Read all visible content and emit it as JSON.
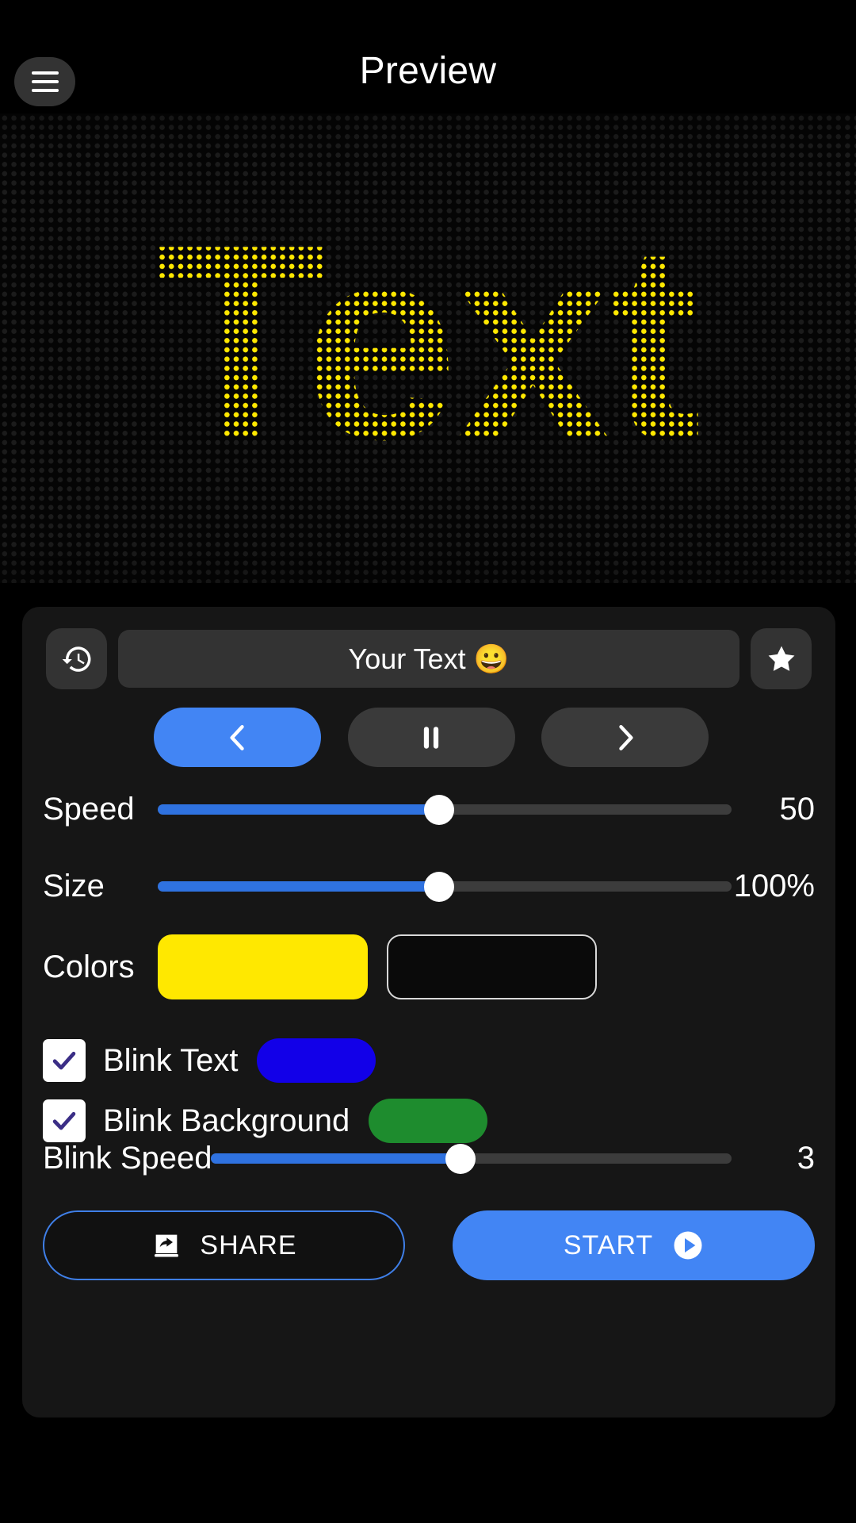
{
  "header": {
    "title": "Preview",
    "menu_icon": "hamburger-menu-icon"
  },
  "display": {
    "text": "Text",
    "text_color": "#FFE800",
    "background_color": "#050505",
    "style": "led-dot-matrix"
  },
  "controls": {
    "history_icon": "history-restore-icon",
    "input_value": "Your Text 😀",
    "input_placeholder": "Your Text",
    "favorite_icon": "star-icon",
    "playback": {
      "prev_label": "‹",
      "prev_icon": "chevron-left-icon",
      "pause_icon": "pause-icon",
      "next_icon": "chevron-right-icon",
      "active": "prev",
      "active_color": "#4285F4"
    },
    "speed": {
      "label": "Speed",
      "value": "50",
      "percent": 49,
      "min": 0,
      "max": 100
    },
    "size": {
      "label": "Size",
      "value": "100%",
      "percent": 49,
      "min": 0,
      "max": 200
    },
    "colors": {
      "label": "Colors",
      "text_color": "#FFE800",
      "background_color": "#0A0A0A"
    },
    "blink_text": {
      "label": "Blink Text",
      "checked": true,
      "color": "#1200E8"
    },
    "blink_background": {
      "label": "Blink Background",
      "checked": true,
      "color": "#1E8C2E"
    },
    "blink_speed": {
      "label": "Blink Speed",
      "value": "3",
      "percent": 48,
      "min": 1,
      "max": 10
    },
    "share_button": {
      "label": "SHARE",
      "icon": "share-icon",
      "border_color": "#3F7FE8"
    },
    "start_button": {
      "label": "START",
      "icon": "play-icon",
      "background_color": "#4285F4"
    }
  }
}
